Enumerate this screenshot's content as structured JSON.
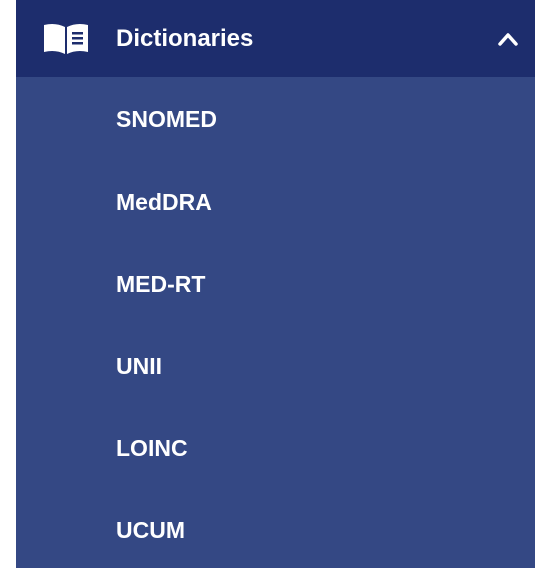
{
  "menu": {
    "title": "Dictionaries",
    "icon": "book-icon",
    "toggle_icon": "chevron-up-icon",
    "expanded": true,
    "items": [
      {
        "label": "SNOMED"
      },
      {
        "label": "MedDRA"
      },
      {
        "label": "MED-RT"
      },
      {
        "label": "UNII"
      },
      {
        "label": "LOINC"
      },
      {
        "label": "UCUM"
      }
    ]
  },
  "colors": {
    "header_bg": "#1d2d6d",
    "menu_bg": "#344884",
    "text": "#ffffff"
  }
}
